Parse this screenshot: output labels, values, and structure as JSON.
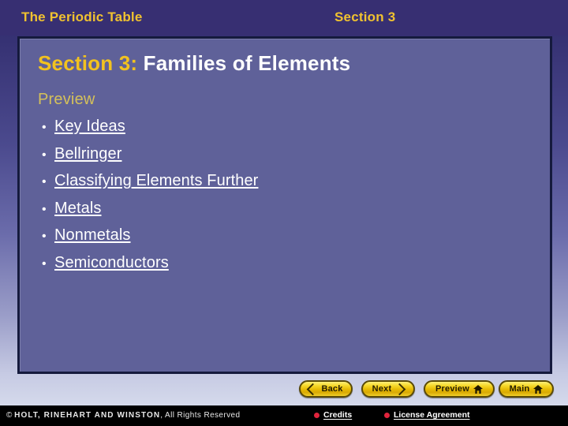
{
  "header": {
    "title": "The Periodic Table",
    "section": "Section 3"
  },
  "slide": {
    "title_accent": "Section 3:",
    "title_main": " Families of Elements",
    "preview_heading": "Preview",
    "bullet_char": "•",
    "links": [
      {
        "label": "Key Ideas"
      },
      {
        "label": "Bellringer"
      },
      {
        "label": "Classifying Elements Further"
      },
      {
        "label": "Metals"
      },
      {
        "label": "Nonmetals"
      },
      {
        "label": "Semiconductors"
      }
    ]
  },
  "nav": {
    "back": "Back",
    "next": "Next",
    "preview": "Preview",
    "main": "Main"
  },
  "footer": {
    "copyright_symbol": "© ",
    "company": "HOLT, RINEHART AND WINSTON",
    "rights": ", All Rights Reserved",
    "credits": "Credits",
    "license": "License Agreement"
  },
  "colors": {
    "header_bg": "#372f72",
    "panel_bg": "#5f6199",
    "panel_border": "#151a3d",
    "accent_gold": "#f2c21f",
    "header_gold": "#f0c230",
    "preview_gold": "#d4c05a",
    "button_gold": "#e7bc06",
    "footer_bg": "#000000",
    "footer_dot_red": "#e0243c",
    "text_white": "#ffffff"
  }
}
